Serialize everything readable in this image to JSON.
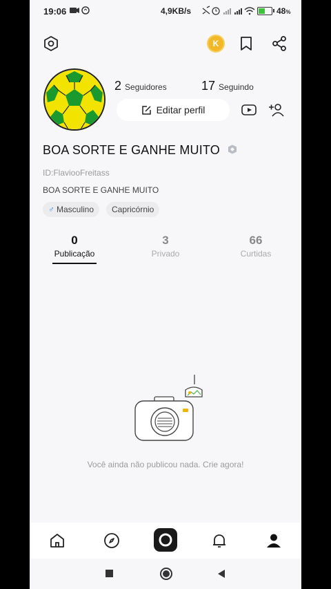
{
  "status_bar": {
    "time": "19:06",
    "network_speed": "4,9KB/s",
    "battery_percent": "48",
    "battery_unit": "%"
  },
  "top_bar": {
    "icons": [
      "settings-hexagon-icon",
      "coin-icon",
      "bookmark-icon",
      "share-icon"
    ],
    "coin_symbol": "K"
  },
  "profile": {
    "followers_count": "2",
    "followers_label": "Seguidores",
    "following_count": "17",
    "following_label": "Seguindo",
    "edit_label": "Editar perfil",
    "name": "BOA SORTE E GANHE MUITO",
    "id_text": "ID:FlaviooFreitass",
    "bio": "BOA SORTE E GANHE MUITO",
    "tags": [
      {
        "icon": "♂",
        "label": "Masculino"
      },
      {
        "label": "Capricórnio"
      }
    ]
  },
  "tabs": [
    {
      "count": "0",
      "label": "Publicação",
      "active": true
    },
    {
      "count": "3",
      "label": "Privado",
      "active": false
    },
    {
      "count": "66",
      "label": "Curtidas",
      "active": false
    }
  ],
  "empty_state": {
    "message": "Você ainda não publicou nada. Crie agora!"
  },
  "bottom_nav": [
    "home-icon",
    "compass-icon",
    "camera-icon",
    "bell-icon",
    "profile-icon"
  ],
  "colors": {
    "accent": "#111111",
    "background": "#f7f7f9",
    "coin": "#f3b82a",
    "ball_yellow": "#f2e400",
    "ball_green": "#1a9a2e"
  }
}
